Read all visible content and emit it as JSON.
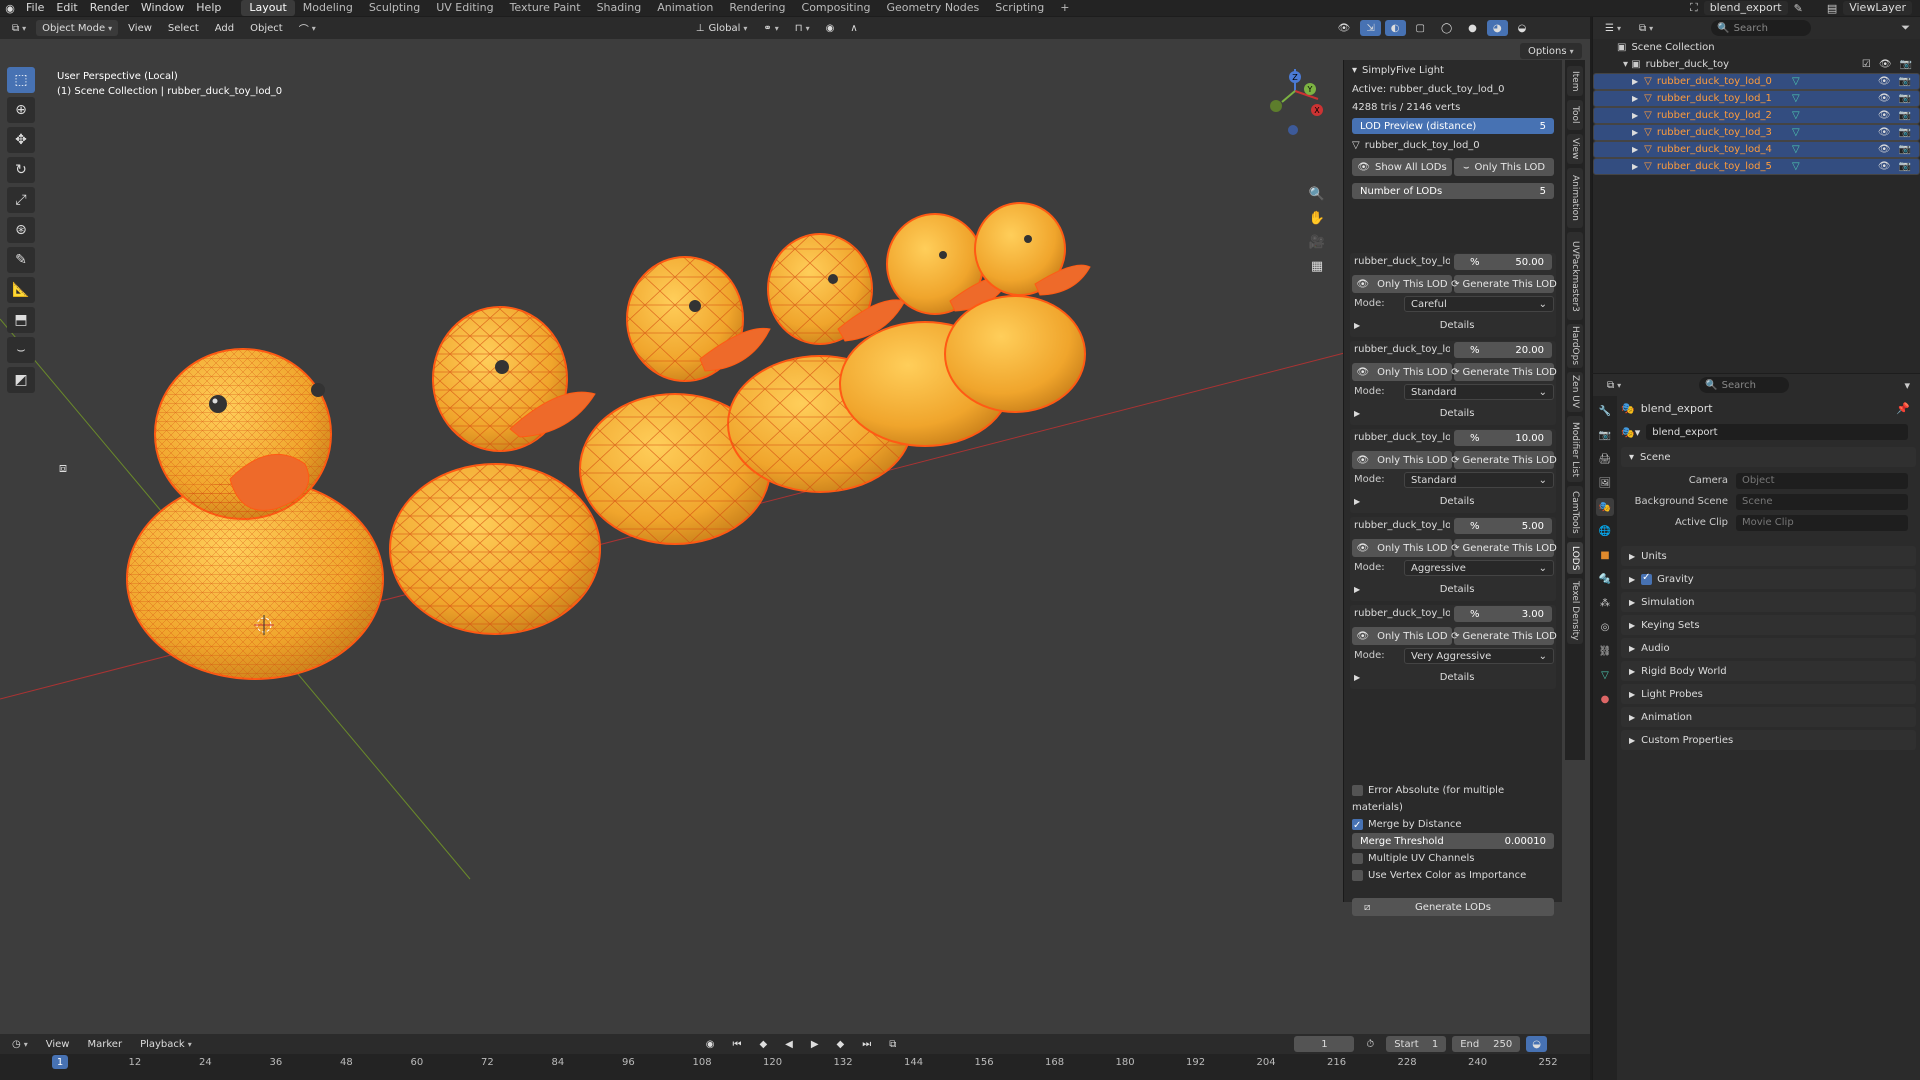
{
  "topmenu": {
    "items": [
      "File",
      "Edit",
      "Render",
      "Window",
      "Help"
    ],
    "workspaces": [
      "Layout",
      "Modeling",
      "Sculpting",
      "UV Editing",
      "Texture Paint",
      "Shading",
      "Animation",
      "Rendering",
      "Compositing",
      "Geometry Nodes",
      "Scripting"
    ],
    "active_workspace": "Layout",
    "add_tab": "+",
    "scene_name": "blend_export",
    "view_layer": "ViewLayer"
  },
  "viewport_header": {
    "mode": "Object Mode",
    "menus": [
      "View",
      "Select",
      "Add",
      "Object"
    ],
    "orientation": "Global",
    "options": "Options"
  },
  "viewport": {
    "perspective": "User Perspective (Local)",
    "collection_path": "(1) Scene Collection | rubber_duck_toy_lod_0",
    "gizmo_x": "X",
    "gizmo_y": "Y",
    "gizmo_z": "Z"
  },
  "npanel": {
    "title": "SimplyFive Light",
    "active": "Active: rubber_duck_toy_lod_0",
    "stats": "4288 tris / 2146 verts",
    "lod_preview_label": "LOD Preview (distance)",
    "lod_preview_value": "5",
    "object_name": "rubber_duck_toy_lod_0",
    "show_all_lods": "Show All LODs",
    "only_this_lod": "Only This LOD",
    "number_of_lods_label": "Number of LODs",
    "number_of_lods_value": "5",
    "lods": [
      {
        "name": "rubber_duck_toy_lo...",
        "pct_label": "%",
        "pct": "50.00",
        "only": "Only This LOD",
        "gen": "Generate This LOD",
        "mode_label": "Mode:",
        "mode": "Careful",
        "details": "Details"
      },
      {
        "name": "rubber_duck_toy_lo...",
        "pct_label": "%",
        "pct": "20.00",
        "only": "Only This LOD",
        "gen": "Generate This LOD",
        "mode_label": "Mode:",
        "mode": "Standard",
        "details": "Details"
      },
      {
        "name": "rubber_duck_toy_lo...",
        "pct_label": "%",
        "pct": "10.00",
        "only": "Only This LOD",
        "gen": "Generate This LOD",
        "mode_label": "Mode:",
        "mode": "Standard",
        "details": "Details"
      },
      {
        "name": "rubber_duck_toy_lo...",
        "pct_label": "%",
        "pct": "5.00",
        "only": "Only This LOD",
        "gen": "Generate This LOD",
        "mode_label": "Mode:",
        "mode": "Aggressive",
        "details": "Details"
      },
      {
        "name": "rubber_duck_toy_lo...",
        "pct_label": "%",
        "pct": "3.00",
        "only": "Only This LOD",
        "gen": "Generate This LOD",
        "mode_label": "Mode:",
        "mode": "Very Aggressive",
        "details": "Details"
      }
    ],
    "error_absolute": "Error Absolute (for multiple materials)",
    "merge_by_distance": "Merge by Distance",
    "merge_threshold_label": "Merge Threshold",
    "merge_threshold_value": "0.00010",
    "multiple_uv": "Multiple UV Channels",
    "vertex_color": "Use Vertex Color as Importance",
    "generate_lods": "Generate LODs"
  },
  "sidetabs": [
    "Item",
    "Tool",
    "View",
    "Animation",
    "UVPackmaster3",
    "HardOps",
    "Zen UV",
    "Modifier List",
    "CamTools",
    "LODS",
    "Texel Density"
  ],
  "timeline": {
    "menus": [
      "View",
      "Marker",
      "Playback"
    ],
    "current_frame": "1",
    "start_label": "Start",
    "start": "1",
    "end_label": "End",
    "end": "250",
    "ticks": [
      "1",
      "12",
      "24",
      "36",
      "48",
      "60",
      "72",
      "84",
      "96",
      "108",
      "120",
      "132",
      "144",
      "156",
      "168",
      "180",
      "192",
      "204",
      "216",
      "228",
      "240",
      "252"
    ]
  },
  "outliner": {
    "search_placeholder": "Search",
    "scene_collection": "Scene Collection",
    "collection": "rubber_duck_toy",
    "objects": [
      "rubber_duck_toy_lod_0",
      "rubber_duck_toy_lod_1",
      "rubber_duck_toy_lod_2",
      "rubber_duck_toy_lod_3",
      "rubber_duck_toy_lod_4",
      "rubber_duck_toy_lod_5"
    ]
  },
  "properties": {
    "search_placeholder": "Search",
    "scene_name": "blend_export",
    "scene_datablock": "blend_export",
    "scene_panel": "Scene",
    "camera_label": "Camera",
    "camera_placeholder": "Object",
    "background_label": "Background Scene",
    "background_placeholder": "Scene",
    "active_clip_label": "Active Clip",
    "active_clip_placeholder": "Movie Clip",
    "panels": [
      "Units",
      "Gravity",
      "Simulation",
      "Keying Sets",
      "Audio",
      "Rigid Body World",
      "Light Probes",
      "Animation",
      "Custom Properties"
    ]
  },
  "colors": {
    "accent": "#4772b3",
    "duck": "#f0a52c",
    "wire": "#ff5a14",
    "selected_text": "#ff9c3b"
  }
}
